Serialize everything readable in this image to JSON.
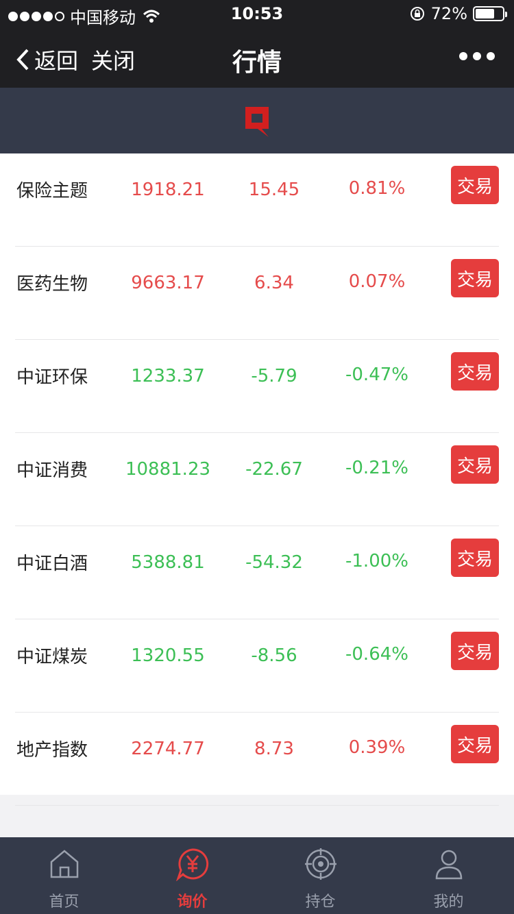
{
  "status": {
    "carrier": "中国移动",
    "time": "10:53",
    "battery": "72%"
  },
  "nav": {
    "back": "返回",
    "close": "关闭",
    "title": "行情"
  },
  "rows": [
    {
      "name": "保险主题",
      "price": "1918.21",
      "change": "15.45",
      "pct": "0.81%",
      "trend": "up",
      "button": "交易"
    },
    {
      "name": "医药生物",
      "price": "9663.17",
      "change": "6.34",
      "pct": "0.07%",
      "trend": "up",
      "button": "交易"
    },
    {
      "name": "中证环保",
      "price": "1233.37",
      "change": "-5.79",
      "pct": "-0.47%",
      "trend": "down",
      "button": "交易"
    },
    {
      "name": "中证消费",
      "price": "10881.23",
      "change": "-22.67",
      "pct": "-0.21%",
      "trend": "down",
      "button": "交易"
    },
    {
      "name": "中证白酒",
      "price": "5388.81",
      "change": "-54.32",
      "pct": "-1.00%",
      "trend": "down",
      "button": "交易"
    },
    {
      "name": "中证煤炭",
      "price": "1320.55",
      "change": "-8.56",
      "pct": "-0.64%",
      "trend": "down",
      "button": "交易"
    },
    {
      "name": "地产指数",
      "price": "2274.77",
      "change": "8.73",
      "pct": "0.39%",
      "trend": "up",
      "button": "交易"
    }
  ],
  "tabs": [
    {
      "label": "首页",
      "icon": "home-icon",
      "active": false
    },
    {
      "label": "询价",
      "icon": "yuan-quote-icon",
      "active": true
    },
    {
      "label": "持仓",
      "icon": "target-icon",
      "active": false
    },
    {
      "label": "我的",
      "icon": "user-icon",
      "active": false
    }
  ],
  "colors": {
    "up": "#e54b4b",
    "down": "#3cbf55",
    "accent": "#e53d3d"
  }
}
